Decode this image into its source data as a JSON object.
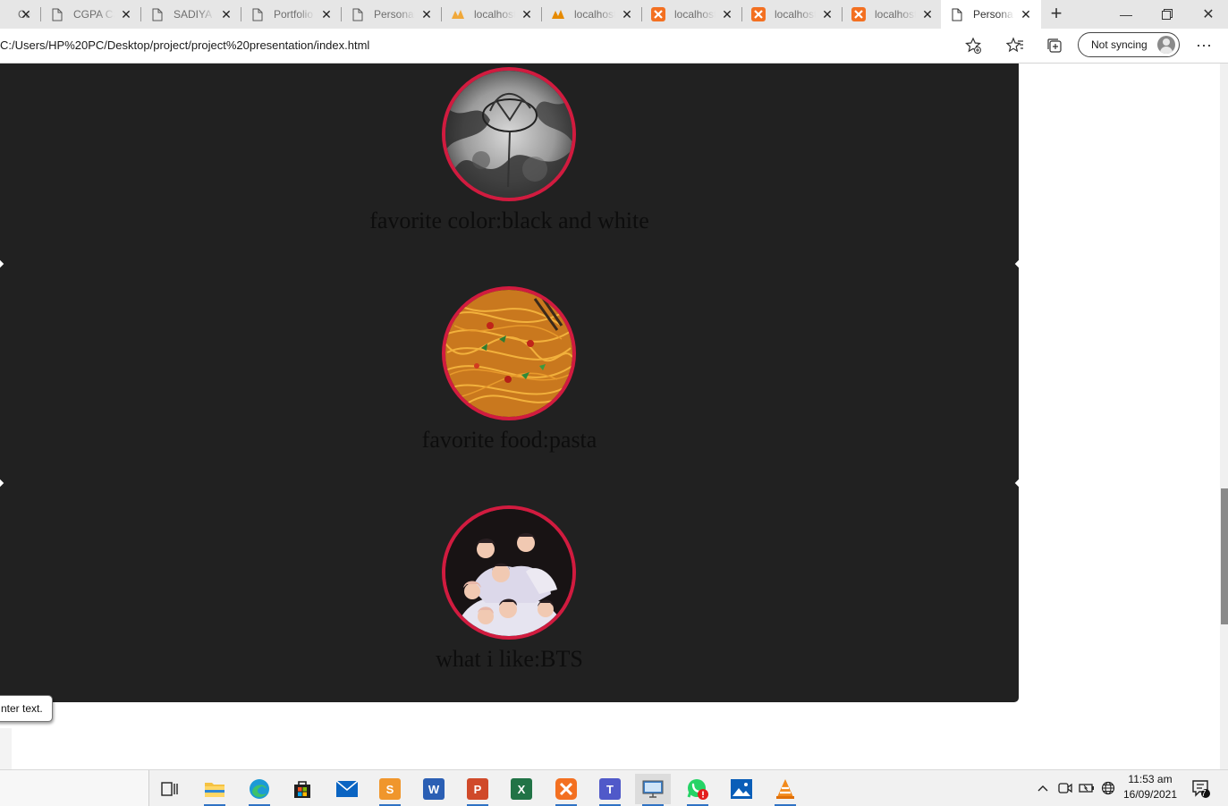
{
  "browser": {
    "tabs": [
      {
        "title": "Ca",
        "favicon": "page-icon"
      },
      {
        "title": "CGPA Ca",
        "favicon": "page-icon"
      },
      {
        "title": "SADIYA",
        "favicon": "page-icon"
      },
      {
        "title": "Portfolio",
        "favicon": "page-icon"
      },
      {
        "title": "Personal",
        "favicon": "page-icon"
      },
      {
        "title": "localhost",
        "favicon": "phpmyadmin-icon"
      },
      {
        "title": "localhost",
        "favicon": "phpmyadmin-icon"
      },
      {
        "title": "localhost",
        "favicon": "xampp-icon"
      },
      {
        "title": "localhost",
        "favicon": "xampp-icon"
      },
      {
        "title": "localhost",
        "favicon": "xampp-icon"
      },
      {
        "title": "Personal",
        "favicon": "page-icon"
      }
    ],
    "url": "C:/Users/HP%20PC/Desktop/project/project%20presentation/index.html",
    "sync_label": "Not syncing",
    "accent_color": "#0067c0"
  },
  "page": {
    "items": [
      {
        "caption": "favorite color:black and white",
        "image": "black-and-white-flower-photo"
      },
      {
        "caption": "favorite food:pasta",
        "image": "pasta-photo"
      },
      {
        "caption": "what i like:BTS",
        "image": "bts-group-photo"
      }
    ],
    "tooltip": "nter text.",
    "circle_border_color": "#d11b3f",
    "background_color": "#212121"
  },
  "taskbar": {
    "apps": [
      "task-view",
      "file-explorer",
      "edge",
      "store",
      "mail",
      "sublime",
      "word",
      "powerpoint",
      "excel",
      "xampp",
      "teams",
      "remote-desktop",
      "whatsapp",
      "photos",
      "vlc"
    ],
    "time": "11:53 am",
    "date": "16/09/2021",
    "notification_count": "7"
  }
}
